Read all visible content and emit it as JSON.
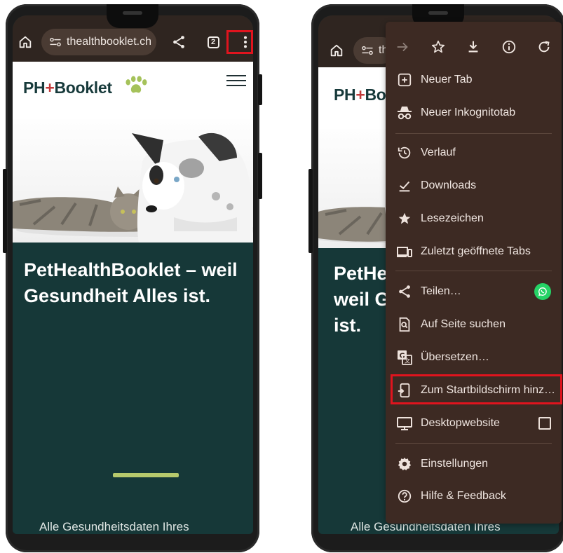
{
  "browser": {
    "url": "thealthbooklet.ch",
    "tab_count": "2",
    "url_partial": "th"
  },
  "page": {
    "logo": {
      "part1": "PH",
      "cross": "+",
      "part2": "Booklet"
    },
    "headline": "PetHealthBooklet – weil Gesundheit Alles ist.",
    "headline_partial": "PetHe weil G ist.",
    "subtext": "Alle Gesundheitsdaten Ihres"
  },
  "menu": {
    "top_icons": [
      "forward-icon",
      "star-icon",
      "download-icon",
      "info-icon",
      "reload-icon"
    ],
    "items": [
      {
        "label": "Neuer Tab",
        "icon": "new-tab-icon"
      },
      {
        "label": "Neuer Inkognitotab",
        "icon": "incognito-icon"
      },
      {
        "label": "Verlauf",
        "icon": "history-icon"
      },
      {
        "label": "Downloads",
        "icon": "downloads-icon"
      },
      {
        "label": "Lesezeichen",
        "icon": "bookmark-star-icon"
      },
      {
        "label": "Zuletzt geöffnete Tabs",
        "icon": "recent-tabs-icon"
      },
      {
        "label": "Teilen…",
        "icon": "share-icon"
      },
      {
        "label": "Auf Seite suchen",
        "icon": "find-in-page-icon"
      },
      {
        "label": "Übersetzen…",
        "icon": "translate-icon"
      },
      {
        "label": "Zum Startbildschirm hinz…",
        "icon": "add-to-home-icon"
      },
      {
        "label": "Desktopwebsite",
        "icon": "desktop-icon"
      },
      {
        "label": "Einstellungen",
        "icon": "settings-icon"
      },
      {
        "label": "Hilfe & Feedback",
        "icon": "help-icon"
      }
    ]
  },
  "colors": {
    "highlight": "#e0141e",
    "page_bg": "#163838",
    "menu_bg": "#3d2a23",
    "accent_green": "#b7c96c"
  }
}
